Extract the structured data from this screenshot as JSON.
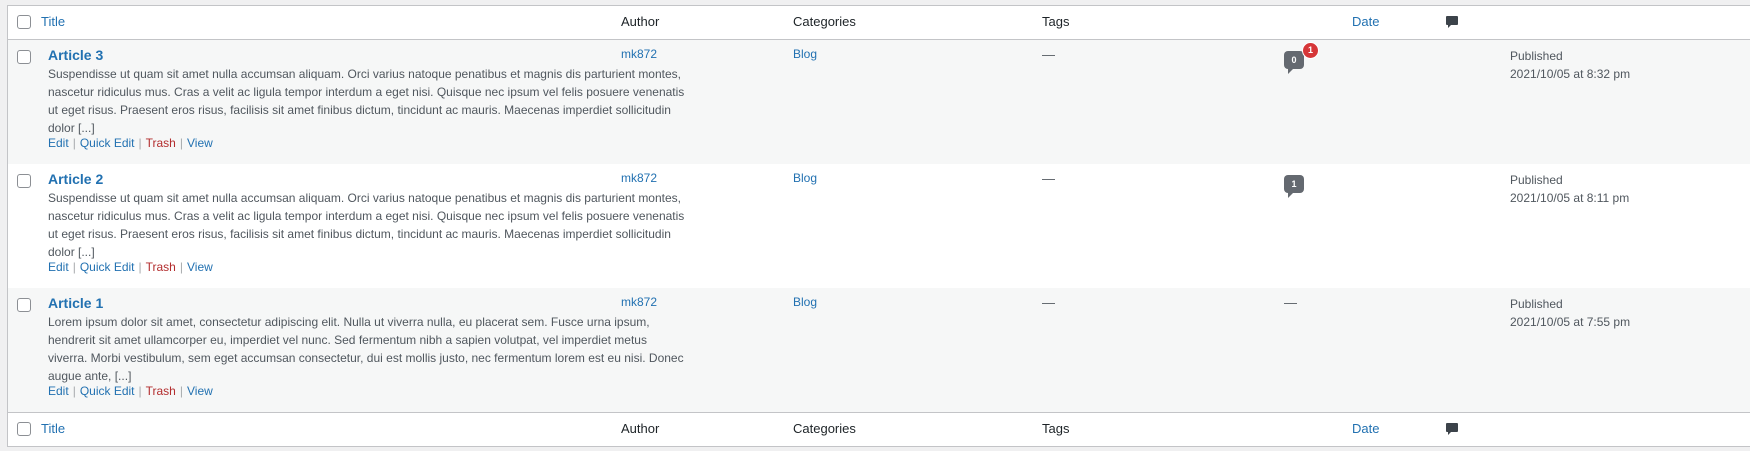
{
  "columns": {
    "title": "Title",
    "author": "Author",
    "categories": "Categories",
    "tags": "Tags",
    "comments_icon": "comment-icon",
    "date": "Date"
  },
  "posts": [
    {
      "title": "Article 3",
      "excerpt": "Suspendisse ut quam sit amet nulla accumsan aliquam. Orci varius natoque penatibus et magnis dis parturient montes, nascetur ridiculus mus. Cras a velit ac ligula tempor interdum a eget nisi. Quisque nec ipsum vel felis posuere venenatis ut eget risus. Praesent eros risus, facilisis sit amet finibus dictum, tincidunt ac mauris. Maecenas imperdiet sollicitudin dolor [...]",
      "author": "mk872",
      "category": "Blog",
      "tags": "—",
      "comments": "0",
      "pending": "1",
      "status": "Published",
      "date": "2021/10/05 at 8:32 pm"
    },
    {
      "title": "Article 2",
      "excerpt": "Suspendisse ut quam sit amet nulla accumsan aliquam. Orci varius natoque penatibus et magnis dis parturient montes, nascetur ridiculus mus. Cras a velit ac ligula tempor interdum a eget nisi. Quisque nec ipsum vel felis posuere venenatis ut eget risus. Praesent eros risus, facilisis sit amet finibus dictum, tincidunt ac mauris. Maecenas imperdiet sollicitudin dolor [...]",
      "author": "mk872",
      "category": "Blog",
      "tags": "—",
      "comments": "1",
      "status": "Published",
      "date": "2021/10/05 at 8:11 pm"
    },
    {
      "title": "Article 1",
      "excerpt": "Lorem ipsum dolor sit amet, consectetur adipiscing elit. Nulla ut viverra nulla, eu placerat sem. Fusce urna ipsum, hendrerit sit amet ullamcorper eu, imperdiet vel nunc. Sed fermentum nibh a sapien volutpat, vel imperdiet metus viverra. Morbi vestibulum, sem eget accumsan consectetur, dui est mollis justo, nec fermentum lorem est eu nisi. Donec augue ante, [...]",
      "author": "mk872",
      "category": "Blog",
      "tags": "—",
      "comments_none": "—",
      "status": "Published",
      "date": "2021/10/05 at 7:55 pm"
    }
  ],
  "actions": {
    "edit": "Edit",
    "quick_edit": "Quick Edit",
    "trash": "Trash",
    "view": "View",
    "separator": "|"
  },
  "colors": {
    "link": "#2271b1",
    "trash": "#b32d2e",
    "pending_badge": "#d63638",
    "comment_bubble": "#646970"
  }
}
